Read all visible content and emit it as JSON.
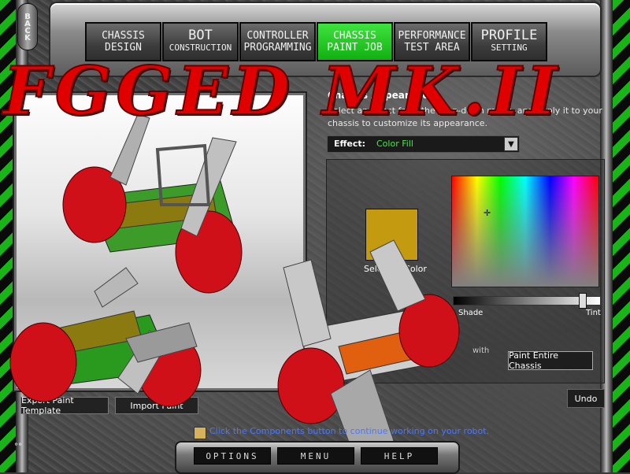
{
  "nav": {
    "back_label": "BACK",
    "tabs": [
      {
        "line1": "CHASSIS",
        "line2": "DESIGN",
        "active": false
      },
      {
        "line1": "BOT",
        "line2": "CONSTRUCTION",
        "active": false
      },
      {
        "line1": "CONTROLLER",
        "line2": "PROGRAMMING",
        "active": false
      },
      {
        "line1": "CHASSIS",
        "line2": "PAINT JOB",
        "active": true
      },
      {
        "line1": "PERFORMANCE",
        "line2": "TEST AREA",
        "active": false
      },
      {
        "line1": "PROFILE",
        "line2": "SETTING",
        "active": false
      }
    ]
  },
  "logo_text": "FGGED MK.II",
  "appearance": {
    "title": "Chassis Appearance",
    "description": "Select an effect from the drop-down menu, and apply it to your chassis to customize its appearance.",
    "effect_label": "Effect:",
    "effect_value": "Color Fill",
    "selected_color_label": "Selected Color",
    "selected_color_hex": "#c39a10",
    "shade_label": "Shade",
    "tint_label": "Tint",
    "with_label": "with",
    "paint_all_button": "Paint Entire Chassis",
    "undo_button": "Undo",
    "export_button": "Export Paint Template",
    "import_button": "Import Paint"
  },
  "hint": {
    "text": "Click the Components button to continue working on your robot."
  },
  "bottom": {
    "options": "OPTIONS",
    "menu": "MENU",
    "help": "HELP"
  },
  "colors": {
    "accent_green": "#12b012",
    "logo_red": "#e10000",
    "hint_blue": "#4a78ff"
  }
}
